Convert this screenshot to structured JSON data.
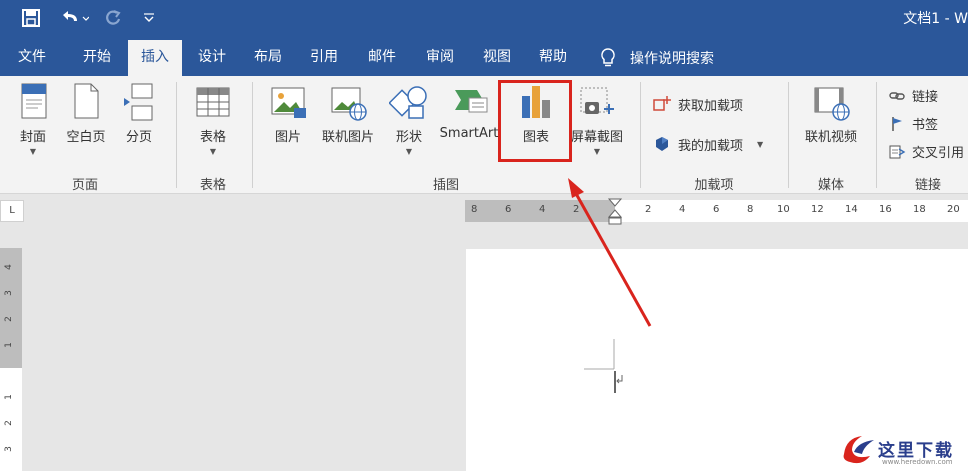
{
  "window": {
    "title": "文档1 - W"
  },
  "tabs": [
    {
      "label": "文件"
    },
    {
      "label": "开始"
    },
    {
      "label": "插入"
    },
    {
      "label": "设计"
    },
    {
      "label": "布局"
    },
    {
      "label": "引用"
    },
    {
      "label": "邮件"
    },
    {
      "label": "审阅"
    },
    {
      "label": "视图"
    },
    {
      "label": "帮助"
    }
  ],
  "tellme": {
    "label": "操作说明搜索"
  },
  "ribbon": {
    "pages": {
      "cover": "封面",
      "blank": "空白页",
      "break": "分页",
      "group": "页面"
    },
    "tables": {
      "table": "表格",
      "group": "表格"
    },
    "illustrations": {
      "picture": "图片",
      "online_picture": "联机图片",
      "shapes": "形状",
      "smartart": "SmartArt",
      "chart": "图表",
      "screenshot": "屏幕截图",
      "group": "插图"
    },
    "addins": {
      "get": "获取加载项",
      "my": "我的加载项",
      "group": "加载项"
    },
    "media": {
      "video": "联机视频",
      "group": "媒体"
    },
    "links": {
      "link": "链接",
      "bookmark": "书签",
      "xref": "交叉引用",
      "group": "链接"
    }
  },
  "ruler": {
    "corner": "L",
    "h_ticks": [
      "8",
      "6",
      "4",
      "2",
      "2",
      "4",
      "6",
      "8",
      "10",
      "12",
      "14",
      "16",
      "18",
      "20"
    ],
    "v_ticks": [
      "4",
      "3",
      "2",
      "1",
      "1",
      "2",
      "3"
    ]
  },
  "watermark": {
    "title": "这里下载",
    "url": "www.heredown.com"
  },
  "colors": {
    "brand": "#2b579a",
    "highlight": "#d9241d"
  }
}
